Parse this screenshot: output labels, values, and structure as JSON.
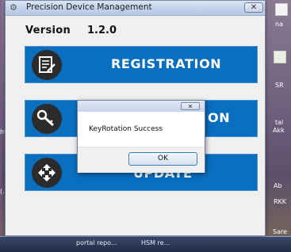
{
  "window": {
    "title": "Precision Device Management",
    "close_glyph": "✕",
    "version_label": "Version",
    "version_value": "1.2.0"
  },
  "buttons": [
    {
      "label": "REGISTRATION",
      "icon": "document-sign-icon"
    },
    {
      "label": "ON",
      "icon": "key-wrench-icon"
    },
    {
      "label": "UPDATE",
      "icon": "sync-arrows-icon"
    }
  ],
  "dialog": {
    "message": "KeyRotation Success",
    "ok_label": "OK",
    "close_glyph": "✕"
  },
  "taskbar": {
    "items": [
      "portal repo...",
      "HSM re..."
    ]
  },
  "desktop_edge": {
    "right_labels": [
      "na",
      "SR",
      "tal",
      "Akk",
      "Ab",
      "RKK",
      "Sare"
    ],
    "left_labels": [
      "ht",
      "(..."
    ]
  },
  "colors": {
    "button_blue": "#0a6fbf",
    "icon_circle": "#2b2b2b"
  }
}
